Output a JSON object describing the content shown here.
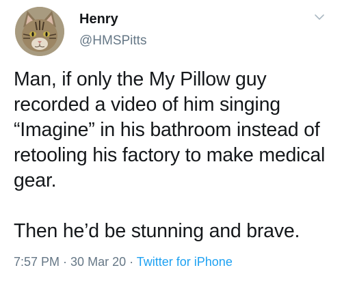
{
  "user": {
    "display_name": "Henry",
    "handle": "@HMSPitts"
  },
  "icons": {
    "avatar": "cat-avatar",
    "menu": "chevron-down-icon"
  },
  "tweet": {
    "paragraph_1": "Man, if only the My Pillow guy recorded a video of him singing “Imagine” in his bathroom instead of retooling his factory to make medical gear.",
    "paragraph_2": "Then he’d be stunning and brave."
  },
  "meta": {
    "time": "7:57 PM",
    "separator": " · ",
    "date": "30 Mar 20",
    "source": "Twitter for iPhone"
  },
  "colors": {
    "text": "#14171a",
    "secondary": "#657786",
    "link": "#1da1f2"
  }
}
